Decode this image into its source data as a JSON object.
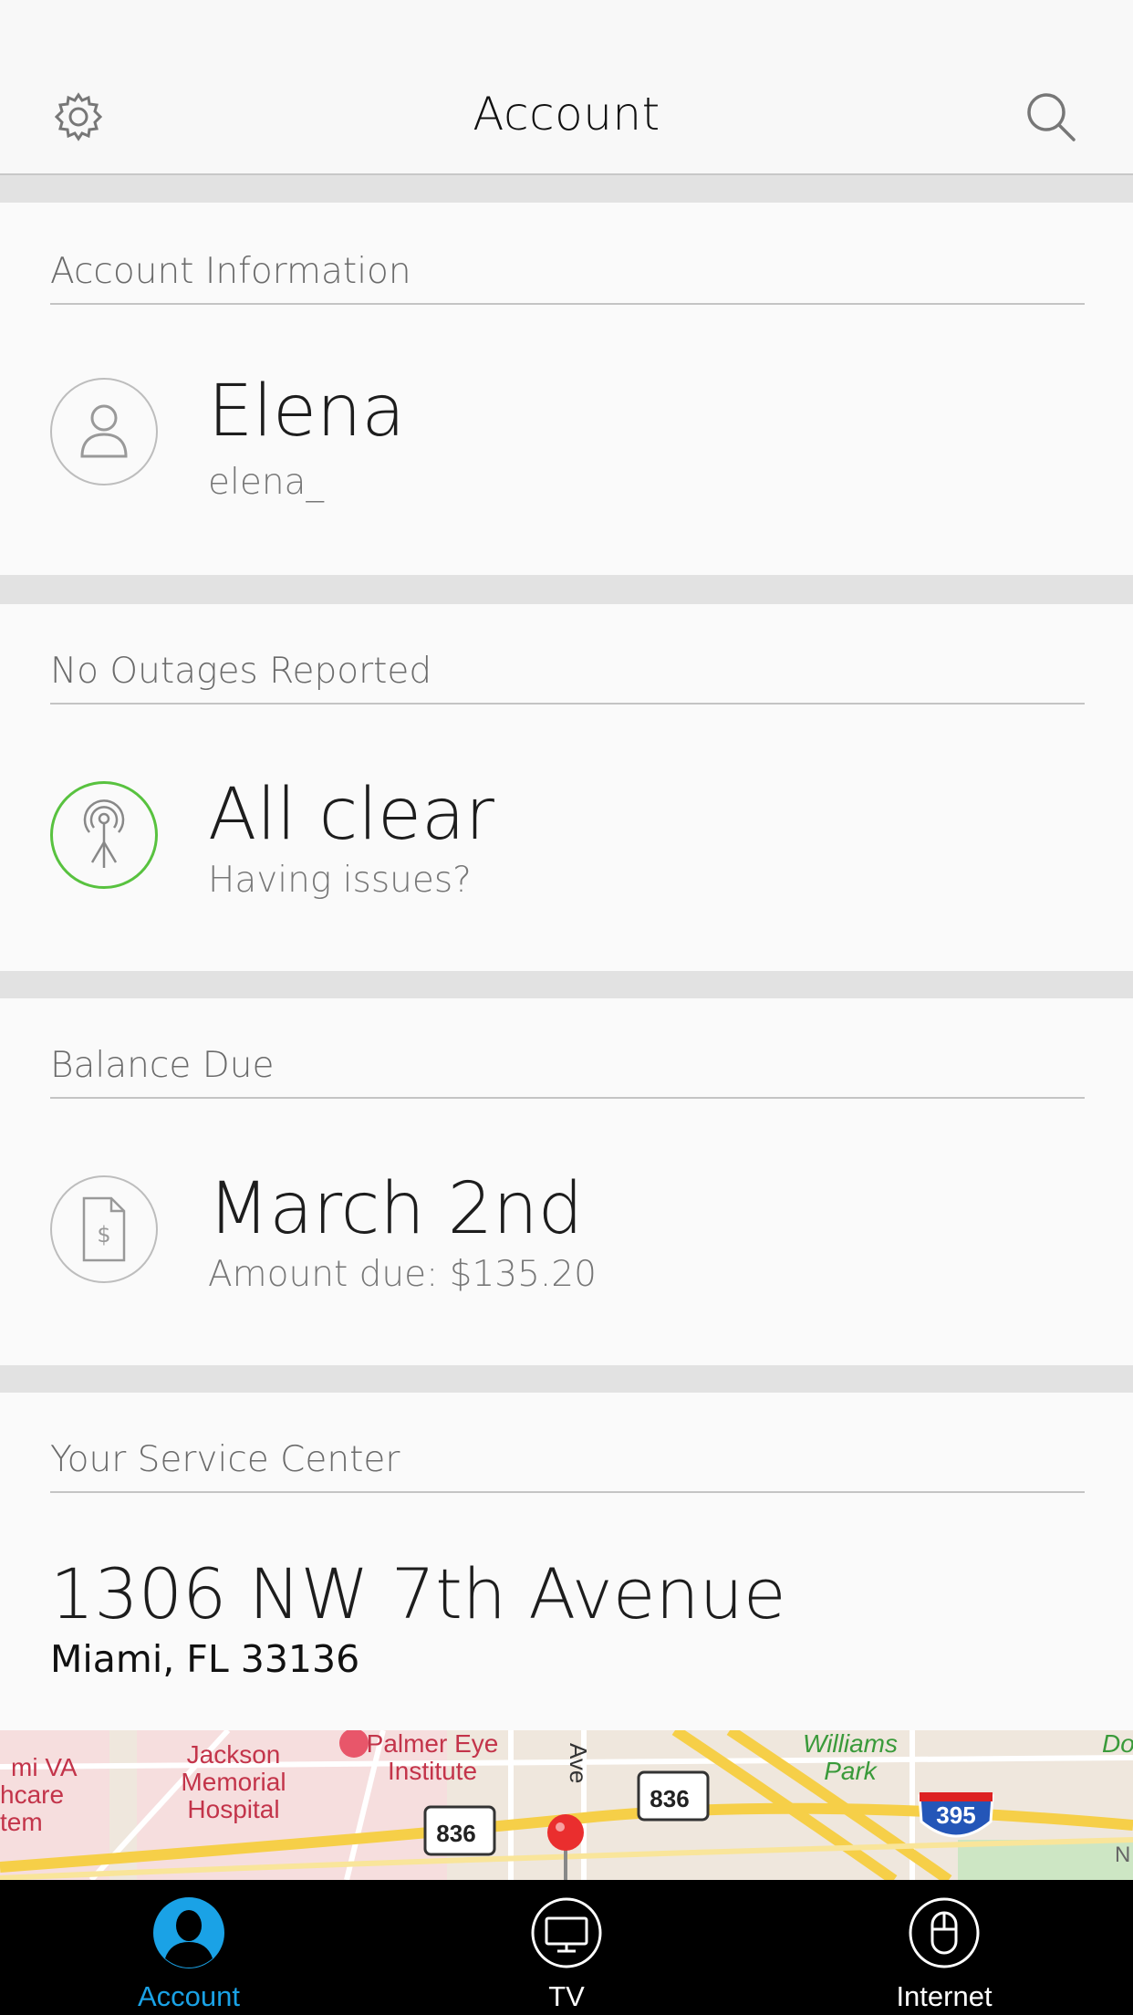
{
  "header": {
    "title": "Account",
    "settings_icon": "gear-icon",
    "search_icon": "search-icon"
  },
  "account_info": {
    "label": "Account Information",
    "name": "Elena",
    "username": "elena_",
    "icon": "user-icon"
  },
  "outages": {
    "label": "No Outages Reported",
    "status": "All clear",
    "link": "Having issues?",
    "icon": "antenna-icon",
    "status_color": "#58c23f"
  },
  "balance": {
    "label": "Balance Due",
    "due_date": "March 2nd",
    "amount_text": "Amount due: $135.20",
    "icon": "bill-icon"
  },
  "service_center": {
    "label": "Your Service Center",
    "street": "1306 NW 7th Avenue",
    "city": "Miami, FL 33136"
  },
  "map": {
    "labels": [
      "mi VA",
      "hcare",
      "tem",
      "Jackson",
      "Memorial",
      "Hospital",
      "Palmer Eye",
      "Institute",
      "Ave",
      "Williams",
      "Park",
      "Do",
      "N"
    ],
    "shields": [
      "836",
      "836",
      "395"
    ]
  },
  "tabbar": {
    "tabs": [
      {
        "label": "Account",
        "icon": "person-icon",
        "active": true
      },
      {
        "label": "TV",
        "icon": "tv-icon",
        "active": false
      },
      {
        "label": "Internet",
        "icon": "mouse-icon",
        "active": false
      }
    ],
    "active_color": "#1aa2e6"
  }
}
